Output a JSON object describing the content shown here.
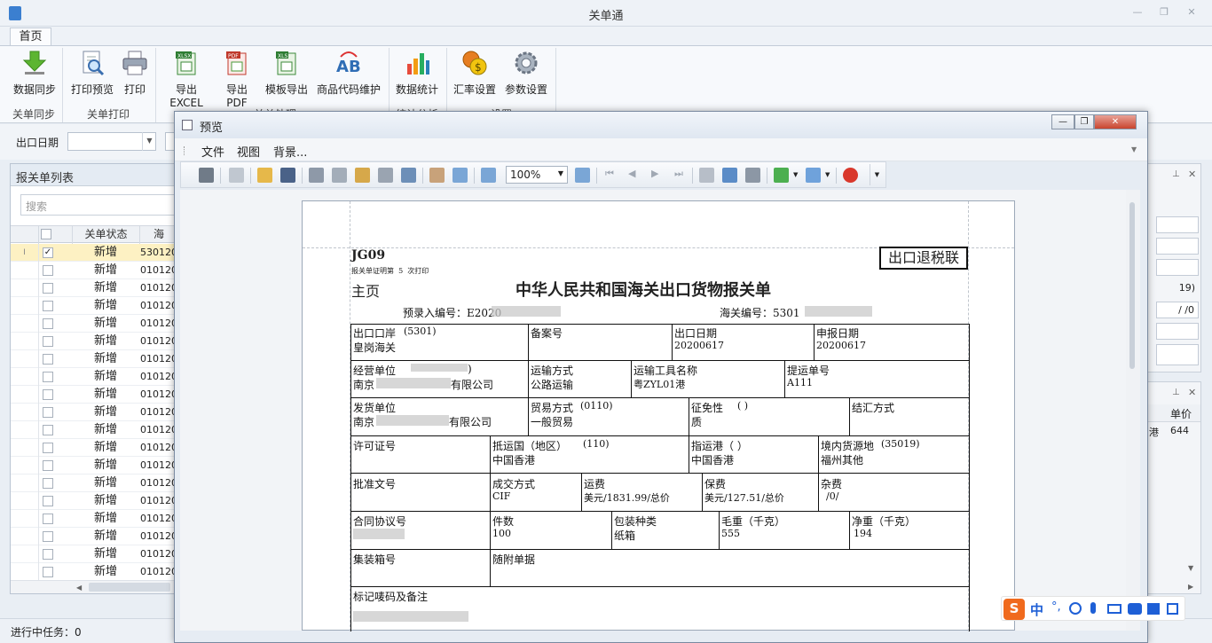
{
  "app": {
    "title": "关单通"
  },
  "ribbon": {
    "tab": "首页",
    "buttons": [
      {
        "label": "数据同步",
        "icon": "download-arrow-icon"
      },
      {
        "label": "打印预览",
        "icon": "print-preview-icon"
      },
      {
        "label": "打印",
        "icon": "printer-icon"
      },
      {
        "label": "导出EXCEL",
        "icon": "excel-export-icon"
      },
      {
        "label": "导出PDF",
        "icon": "pdf-export-icon"
      },
      {
        "label": "模板导出",
        "icon": "template-export-icon"
      },
      {
        "label": "商品代码维护",
        "icon": "product-code-icon"
      },
      {
        "label": "数据统计",
        "icon": "bar-chart-icon"
      },
      {
        "label": "汇率设置",
        "icon": "exchange-rate-icon"
      },
      {
        "label": "参数设置",
        "icon": "gear-icon"
      }
    ],
    "groups": [
      "关单同步",
      "关单打印",
      "关单处理",
      "统计分析",
      "设置"
    ]
  },
  "filter": {
    "date_label": "出口日期"
  },
  "list_panel": {
    "title": "报关单列表",
    "search_placeholder": "搜索",
    "col_status": "关单状态",
    "col_no": "海",
    "rows": [
      {
        "status": "新增",
        "no": "530120",
        "checked": true
      },
      {
        "status": "新增",
        "no": "010120"
      },
      {
        "status": "新增",
        "no": "010120"
      },
      {
        "status": "新增",
        "no": "010120"
      },
      {
        "status": "新增",
        "no": "010120"
      },
      {
        "status": "新增",
        "no": "010120"
      },
      {
        "status": "新增",
        "no": "010120"
      },
      {
        "status": "新增",
        "no": "010120"
      },
      {
        "status": "新增",
        "no": "010120"
      },
      {
        "status": "新增",
        "no": "010120"
      },
      {
        "status": "新增",
        "no": "010120"
      },
      {
        "status": "新增",
        "no": "010120"
      },
      {
        "status": "新增",
        "no": "010120"
      },
      {
        "status": "新增",
        "no": "010120"
      },
      {
        "status": "新增",
        "no": "010120"
      },
      {
        "status": "新增",
        "no": "010120"
      },
      {
        "status": "新增",
        "no": "010120"
      },
      {
        "status": "新增",
        "no": "010120"
      },
      {
        "status": "新增",
        "no": "010120"
      }
    ]
  },
  "status_bar": {
    "text": "进行中任务：0"
  },
  "right_panel": {
    "val1": "19)",
    "val2": " / /0",
    "col1": "单价",
    "cell1": "港",
    "cell2": "644"
  },
  "preview": {
    "title": "预览",
    "menu": [
      "文件",
      "视图",
      "背景..."
    ],
    "zoom": "100%",
    "doc": {
      "code": "JG09",
      "sub": "报关单证明第  5  次打印",
      "stamp": "出口退税联",
      "main_page": "主页",
      "heading": "中华人民共和国海关出口货物报关单",
      "pre_no_label": "预录入编号：E2020",
      "customs_no_label": "海关编号：5301",
      "fields": {
        "port_label": "出口口岸",
        "port_code": "(5301)",
        "port_value": "皇岗海关",
        "record_label": "备案号",
        "export_date_label": "出口日期",
        "export_date": "20200617",
        "declare_date_label": "申报日期",
        "declare_date": "20200617",
        "operator_label": "经营单位",
        "operator_paren": ")",
        "operator_prefix": "南京",
        "operator_suffix": "有限公司",
        "transport_label": "运输方式",
        "transport_value": "公路运输",
        "vehicle_label": "运输工具名称",
        "vehicle_value": "粤ZYL01港",
        "bill_label": "提运单号",
        "bill_value": "A111",
        "shipper_label": "发货单位",
        "shipper_prefix": "南京",
        "shipper_suffix": "有限公司",
        "trade_label": "贸易方式",
        "trade_code": "(0110)",
        "trade_value": "一般贸易",
        "tax_label": "征免性",
        "tax_code": "( )",
        "tax_value": "质",
        "settle_label": "结汇方式",
        "license_label": "许可证号",
        "dest_country_label": "抵运国（地区）",
        "dest_country_code": "(110)",
        "dest_country_value": "中国香港",
        "dest_port_label": "指运港（ ）",
        "dest_port_value": "中国香港",
        "origin_label": "境内货源地",
        "origin_code": "(35019)",
        "origin_value": "福州其他",
        "approval_label": "批准文号",
        "deal_label": "成交方式",
        "deal_value": "CIF",
        "freight_label": "运费",
        "freight_value": "美元/1831.99/总价",
        "insurance_label": "保费",
        "insurance_value": "美元/127.51/总价",
        "misc_label": "杂费",
        "misc_value": "/0/",
        "contract_label": "合同协议号",
        "pieces_label": "件数",
        "pieces_value": "100",
        "package_label": "包装种类",
        "package_value": "纸箱",
        "gross_label": "毛重（千克）",
        "gross_value": "555",
        "net_label": "净重（千克）",
        "net_value": "194",
        "container_label": "集装箱号",
        "docs_label": "随附单据",
        "marks_label": "标记唛码及备注"
      }
    }
  },
  "ime": {
    "text": "中"
  }
}
